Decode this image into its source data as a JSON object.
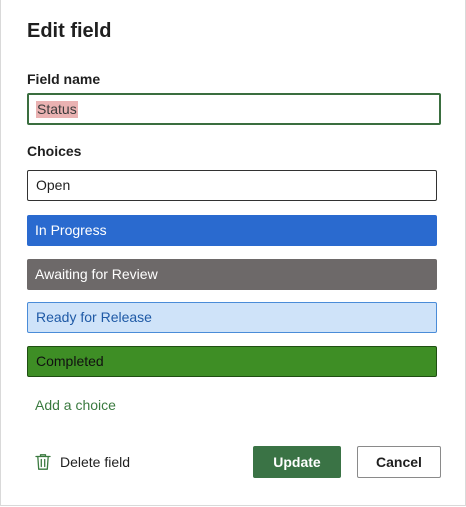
{
  "dialog": {
    "title": "Edit field",
    "field_name_label": "Field name",
    "field_name_value": "Status",
    "choices_label": "Choices",
    "choices": [
      {
        "label": "Open",
        "color": "#ffffff"
      },
      {
        "label": "In Progress",
        "color": "#2a6acf"
      },
      {
        "label": "Awaiting for Review",
        "color": "#6d6969"
      },
      {
        "label": "Ready for Release",
        "color": "#cfe3f9"
      },
      {
        "label": "Completed",
        "color": "#3e8e25"
      }
    ],
    "add_choice_label": "Add a choice",
    "delete_label": "Delete field",
    "delete_icon": "trash-icon",
    "update_label": "Update",
    "cancel_label": "Cancel",
    "accent_color": "#3a7345"
  }
}
